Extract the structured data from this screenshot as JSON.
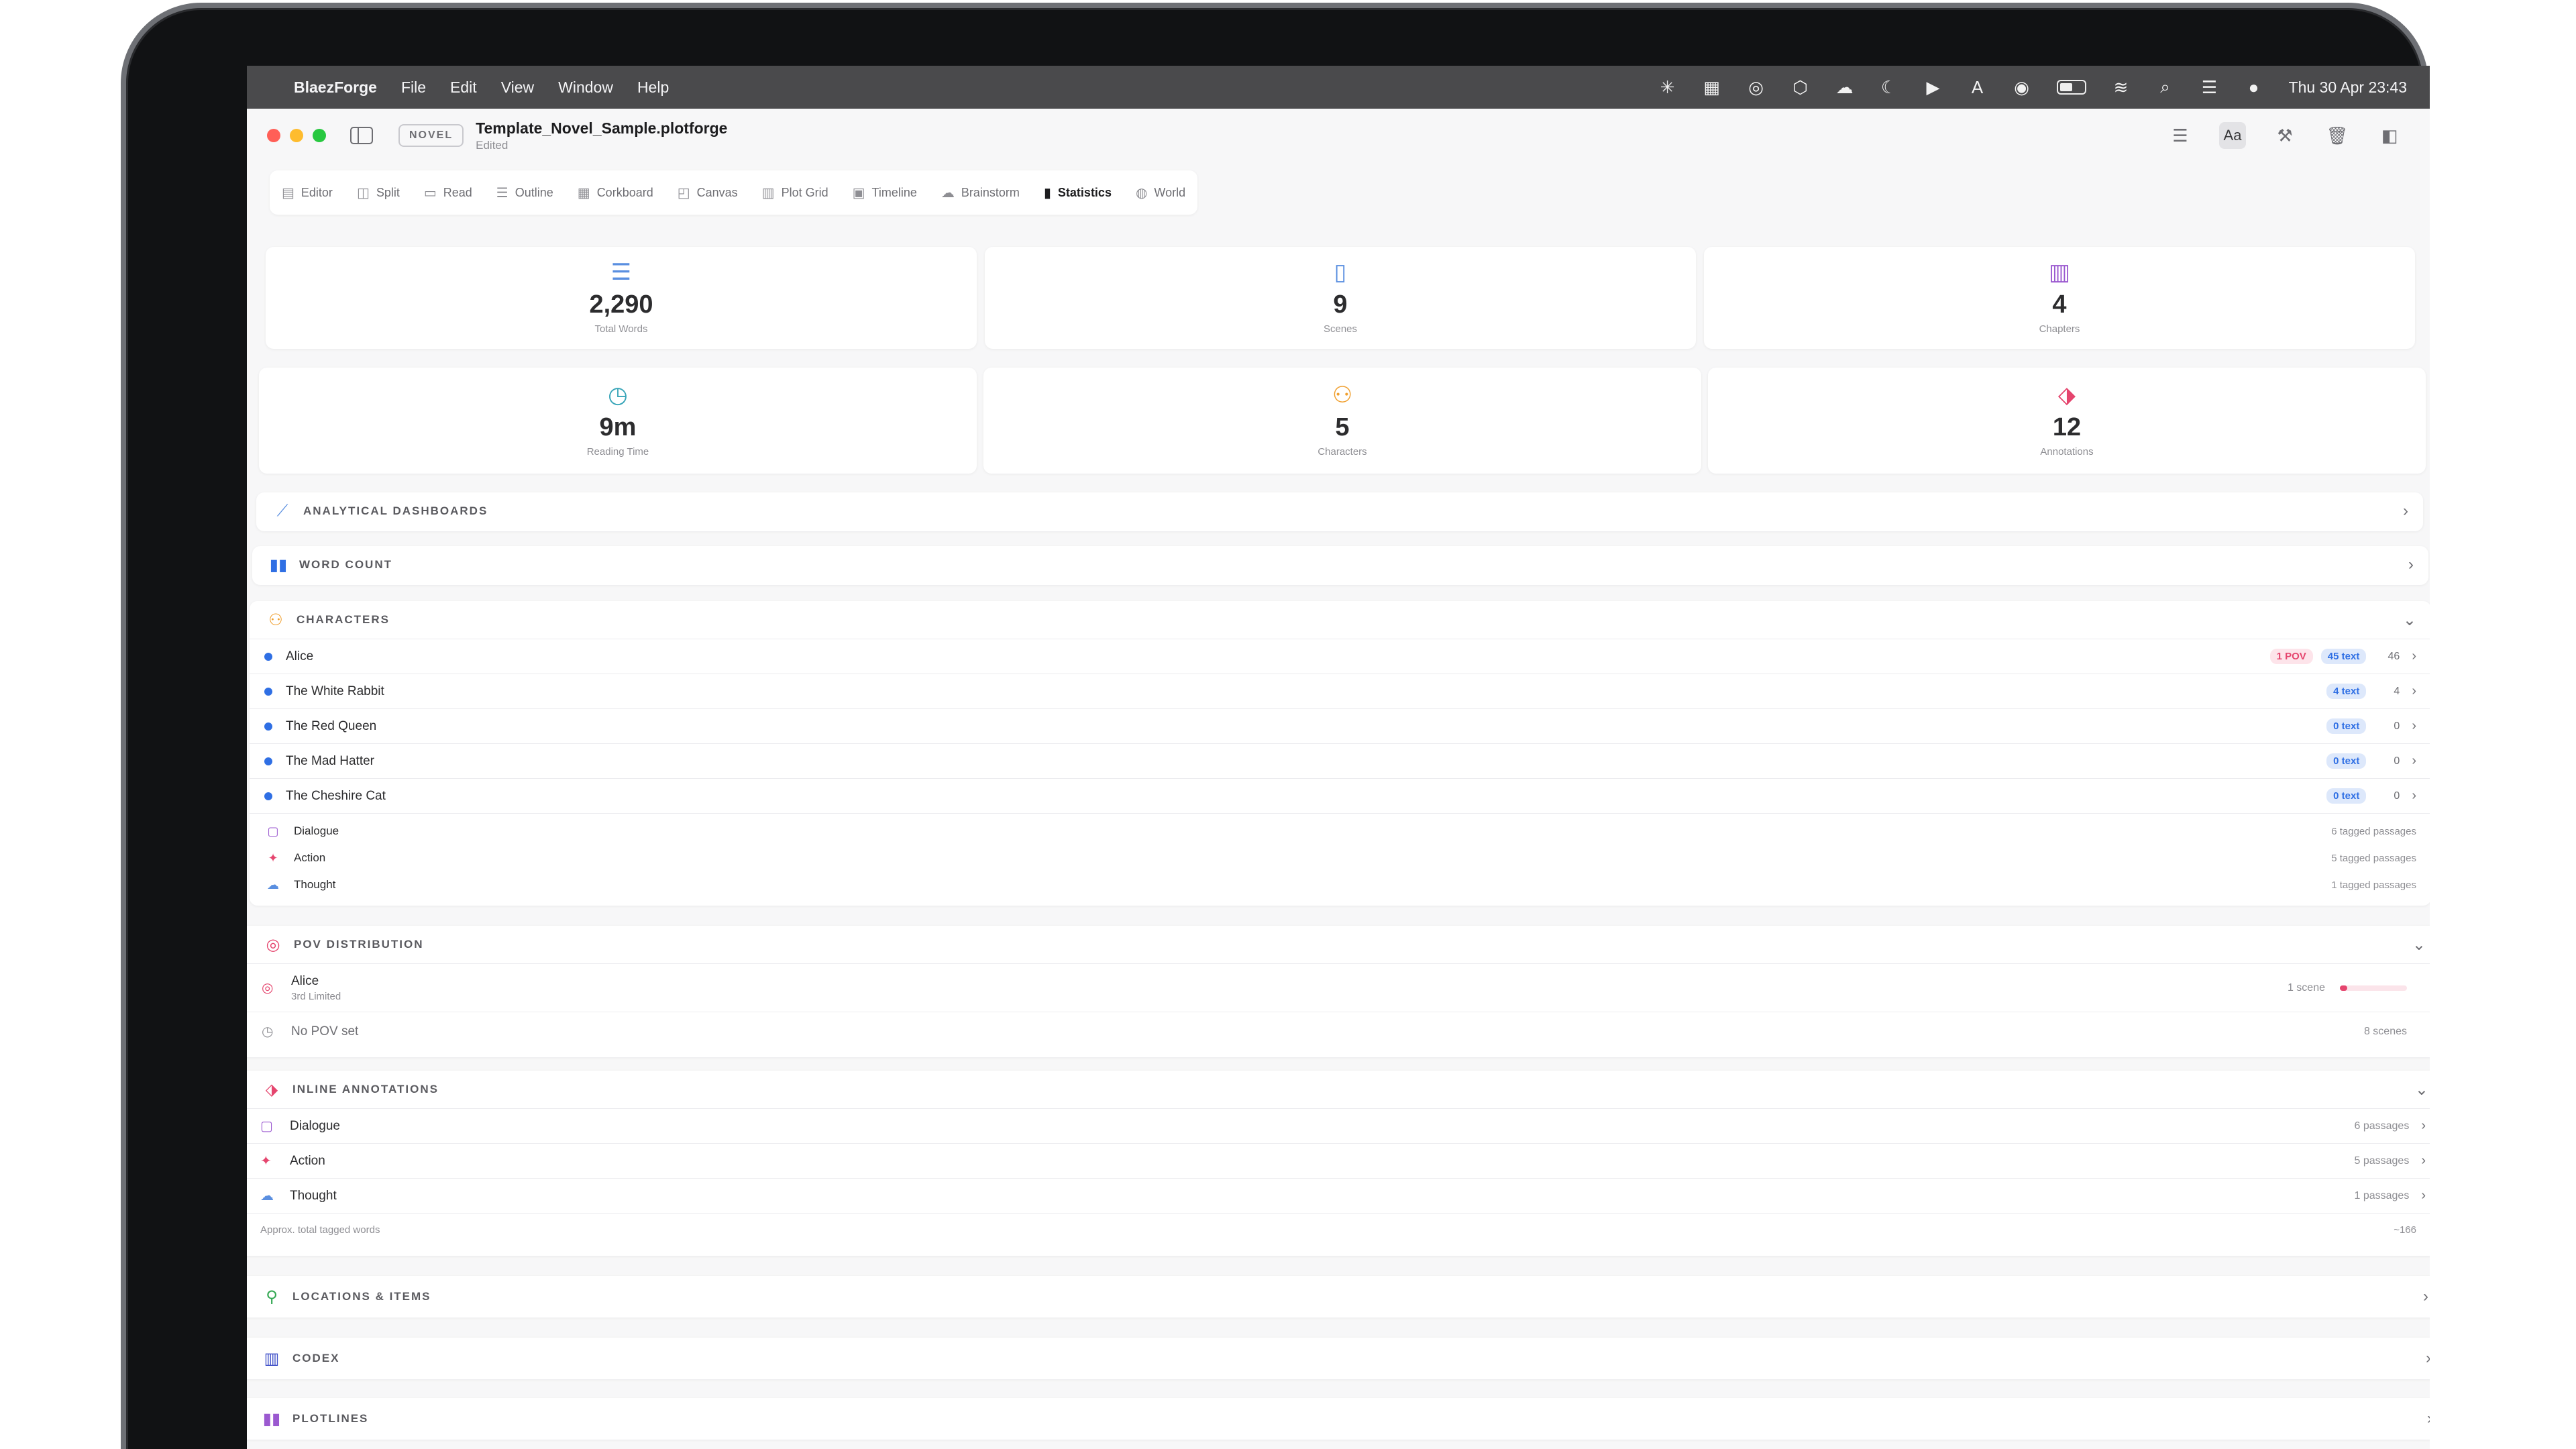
{
  "menubar": {
    "app_name": "BlaezForge",
    "menus": [
      "File",
      "Edit",
      "View",
      "Window",
      "Help"
    ],
    "clock": "Thu 30 Apr  23:43"
  },
  "titlebar": {
    "badge": "NOVEL",
    "filename": "Template_Novel_Sample.plotforge",
    "status": "Edited",
    "font_button": "Aa"
  },
  "tabs": [
    {
      "label": "Editor",
      "icon": "document-icon"
    },
    {
      "label": "Split",
      "icon": "split-icon"
    },
    {
      "label": "Read",
      "icon": "book-icon"
    },
    {
      "label": "Outline",
      "icon": "list-icon"
    },
    {
      "label": "Corkboard",
      "icon": "grid-icon"
    },
    {
      "label": "Canvas",
      "icon": "canvas-icon"
    },
    {
      "label": "Plot Grid",
      "icon": "columns-icon"
    },
    {
      "label": "Timeline",
      "icon": "calendar-icon"
    },
    {
      "label": "Brainstorm",
      "icon": "cloud-icon"
    },
    {
      "label": "Statistics",
      "icon": "bar-chart-icon",
      "active": true
    },
    {
      "label": "World",
      "icon": "globe-icon"
    }
  ],
  "stats": {
    "total_words": {
      "value": "2,290",
      "label": "Total Words"
    },
    "scenes": {
      "value": "9",
      "label": "Scenes"
    },
    "chapters": {
      "value": "4",
      "label": "Chapters"
    },
    "reading_time": {
      "value": "9m",
      "label": "Reading Time"
    },
    "characters": {
      "value": "5",
      "label": "Characters"
    },
    "annotations": {
      "value": "12",
      "label": "Annotations"
    }
  },
  "sections": {
    "analytical": "ANALYTICAL DASHBOARDS",
    "word_count": "WORD COUNT",
    "characters": "CHARACTERS",
    "pov": "POV DISTRIBUTION",
    "inline": "INLINE ANNOTATIONS",
    "locations": "LOCATIONS & ITEMS",
    "codex": "CODEX",
    "plotlines": "PLOTLINES"
  },
  "characters": [
    {
      "name": "Alice",
      "pov": "1 POV",
      "text": "45 text",
      "count": "46"
    },
    {
      "name": "The White Rabbit",
      "text": "4 text",
      "count": "4"
    },
    {
      "name": "The Red Queen",
      "text": "0 text",
      "count": "0"
    },
    {
      "name": "The Mad Hatter",
      "text": "0 text",
      "count": "0"
    },
    {
      "name": "The Cheshire Cat",
      "text": "0 text",
      "count": "0"
    }
  ],
  "tag_types": [
    {
      "name": "Dialogue",
      "meta": "6 tagged passages"
    },
    {
      "name": "Action",
      "meta": "5 tagged passages"
    },
    {
      "name": "Thought",
      "meta": "1 tagged passages"
    }
  ],
  "pov": {
    "character": "Alice",
    "mode": "3rd Limited",
    "scenes": "1 scene",
    "share": 0.11,
    "no_pov_label": "No POV set",
    "no_pov_scenes": "8 scenes"
  },
  "inline": {
    "rows": [
      {
        "name": "Dialogue",
        "meta": "6 passages"
      },
      {
        "name": "Action",
        "meta": "5 passages"
      },
      {
        "name": "Thought",
        "meta": "1 passages"
      }
    ],
    "footer_label": "Approx. total tagged words",
    "footer_value": "~166"
  },
  "colors": {
    "accent_blue": "#2f6fe4",
    "pov_pink": "#e5456e",
    "purple": "#9b59d0",
    "orange": "#f0a030",
    "green": "#34a853"
  }
}
